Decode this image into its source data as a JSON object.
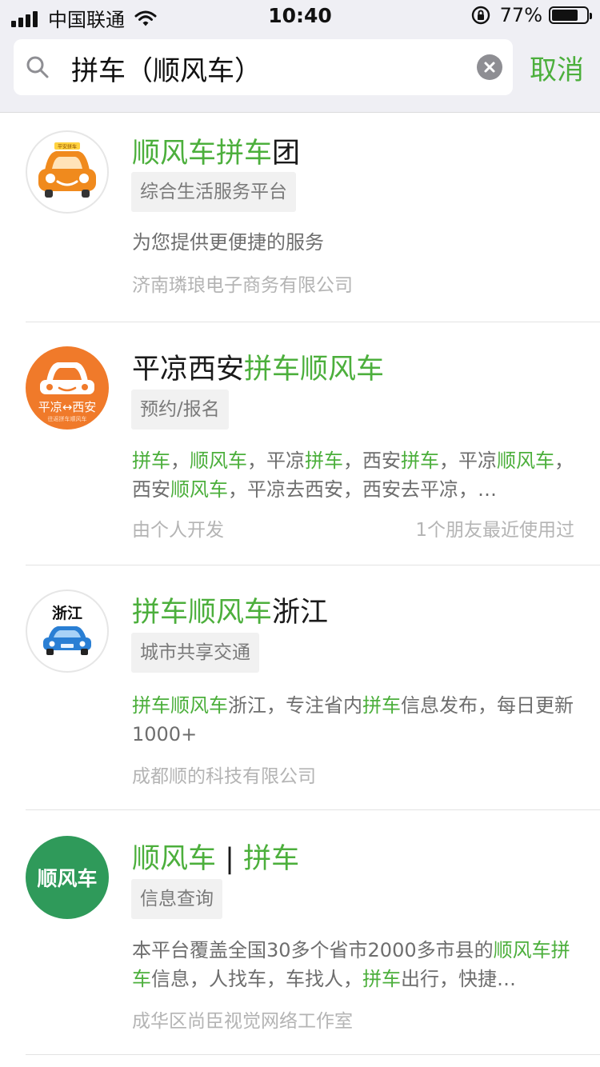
{
  "status_bar": {
    "carrier": "中国联通",
    "time": "10:40",
    "battery": "77%",
    "battery_level": 0.77
  },
  "search": {
    "query": "拼车（顺风车）",
    "cancel_label": "取消"
  },
  "results": [
    {
      "title": [
        {
          "t": "顺风车拼车",
          "h": true
        },
        {
          "t": "团",
          "h": false
        }
      ],
      "logo_text": "平安拼车",
      "tag": "综合生活服务平台",
      "desc": [
        {
          "t": "为您提供更便捷的服务",
          "h": false
        }
      ],
      "meta": "济南璘琅电子商务有限公司",
      "meta_right": ""
    },
    {
      "title": [
        {
          "t": "平凉西安",
          "h": false
        },
        {
          "t": "拼车顺风车",
          "h": true
        }
      ],
      "logo_text": "平凉↔西安",
      "logo_subtext": "往返拼车顺风车",
      "tag": "预约/报名",
      "desc": [
        {
          "t": "拼车",
          "h": true
        },
        {
          "t": "，",
          "h": false
        },
        {
          "t": "顺风车",
          "h": true
        },
        {
          "t": "，平凉",
          "h": false
        },
        {
          "t": "拼车",
          "h": true
        },
        {
          "t": "，西安",
          "h": false
        },
        {
          "t": "拼车",
          "h": true
        },
        {
          "t": "，平凉",
          "h": false
        },
        {
          "t": "顺风车",
          "h": true
        },
        {
          "t": "，西安",
          "h": false
        },
        {
          "t": "顺风车",
          "h": true
        },
        {
          "t": "，平凉去西安，西安去平凉，…",
          "h": false
        }
      ],
      "meta": "由个人开发",
      "meta_right": "1个朋友最近使用过"
    },
    {
      "title": [
        {
          "t": "拼车顺风车",
          "h": true
        },
        {
          "t": "浙江",
          "h": false
        }
      ],
      "logo_text": "浙江",
      "tag": "城市共享交通",
      "desc": [
        {
          "t": "拼车顺风车",
          "h": true
        },
        {
          "t": "浙江，专注省内",
          "h": false
        },
        {
          "t": "拼车",
          "h": true
        },
        {
          "t": "信息发布，每日更新1000+",
          "h": false
        }
      ],
      "meta": "成都顺的科技有限公司",
      "meta_right": ""
    },
    {
      "title": [
        {
          "t": "顺风车",
          "h": true
        },
        {
          "t": " | ",
          "h": false
        },
        {
          "t": "拼车",
          "h": true
        }
      ],
      "logo_text": "顺风车",
      "tag": "信息查询",
      "desc": [
        {
          "t": "本平台覆盖全国30多个省市2000多市县的",
          "h": false
        },
        {
          "t": "顺风车",
          "h": true
        },
        {
          "t": "拼车",
          "h": true
        },
        {
          "t": "信息，人找车，车找人，",
          "h": false
        },
        {
          "t": "拼车",
          "h": true
        },
        {
          "t": "出行，快捷…",
          "h": false
        }
      ],
      "meta": "成华区尚臣视觉网络工作室",
      "meta_right": ""
    }
  ],
  "colors": {
    "accent": "#4caf3c",
    "logo_orange": "#f08a1d",
    "logo_green": "#2f9a5a",
    "logo_blue_car": "#2a7fd4"
  }
}
